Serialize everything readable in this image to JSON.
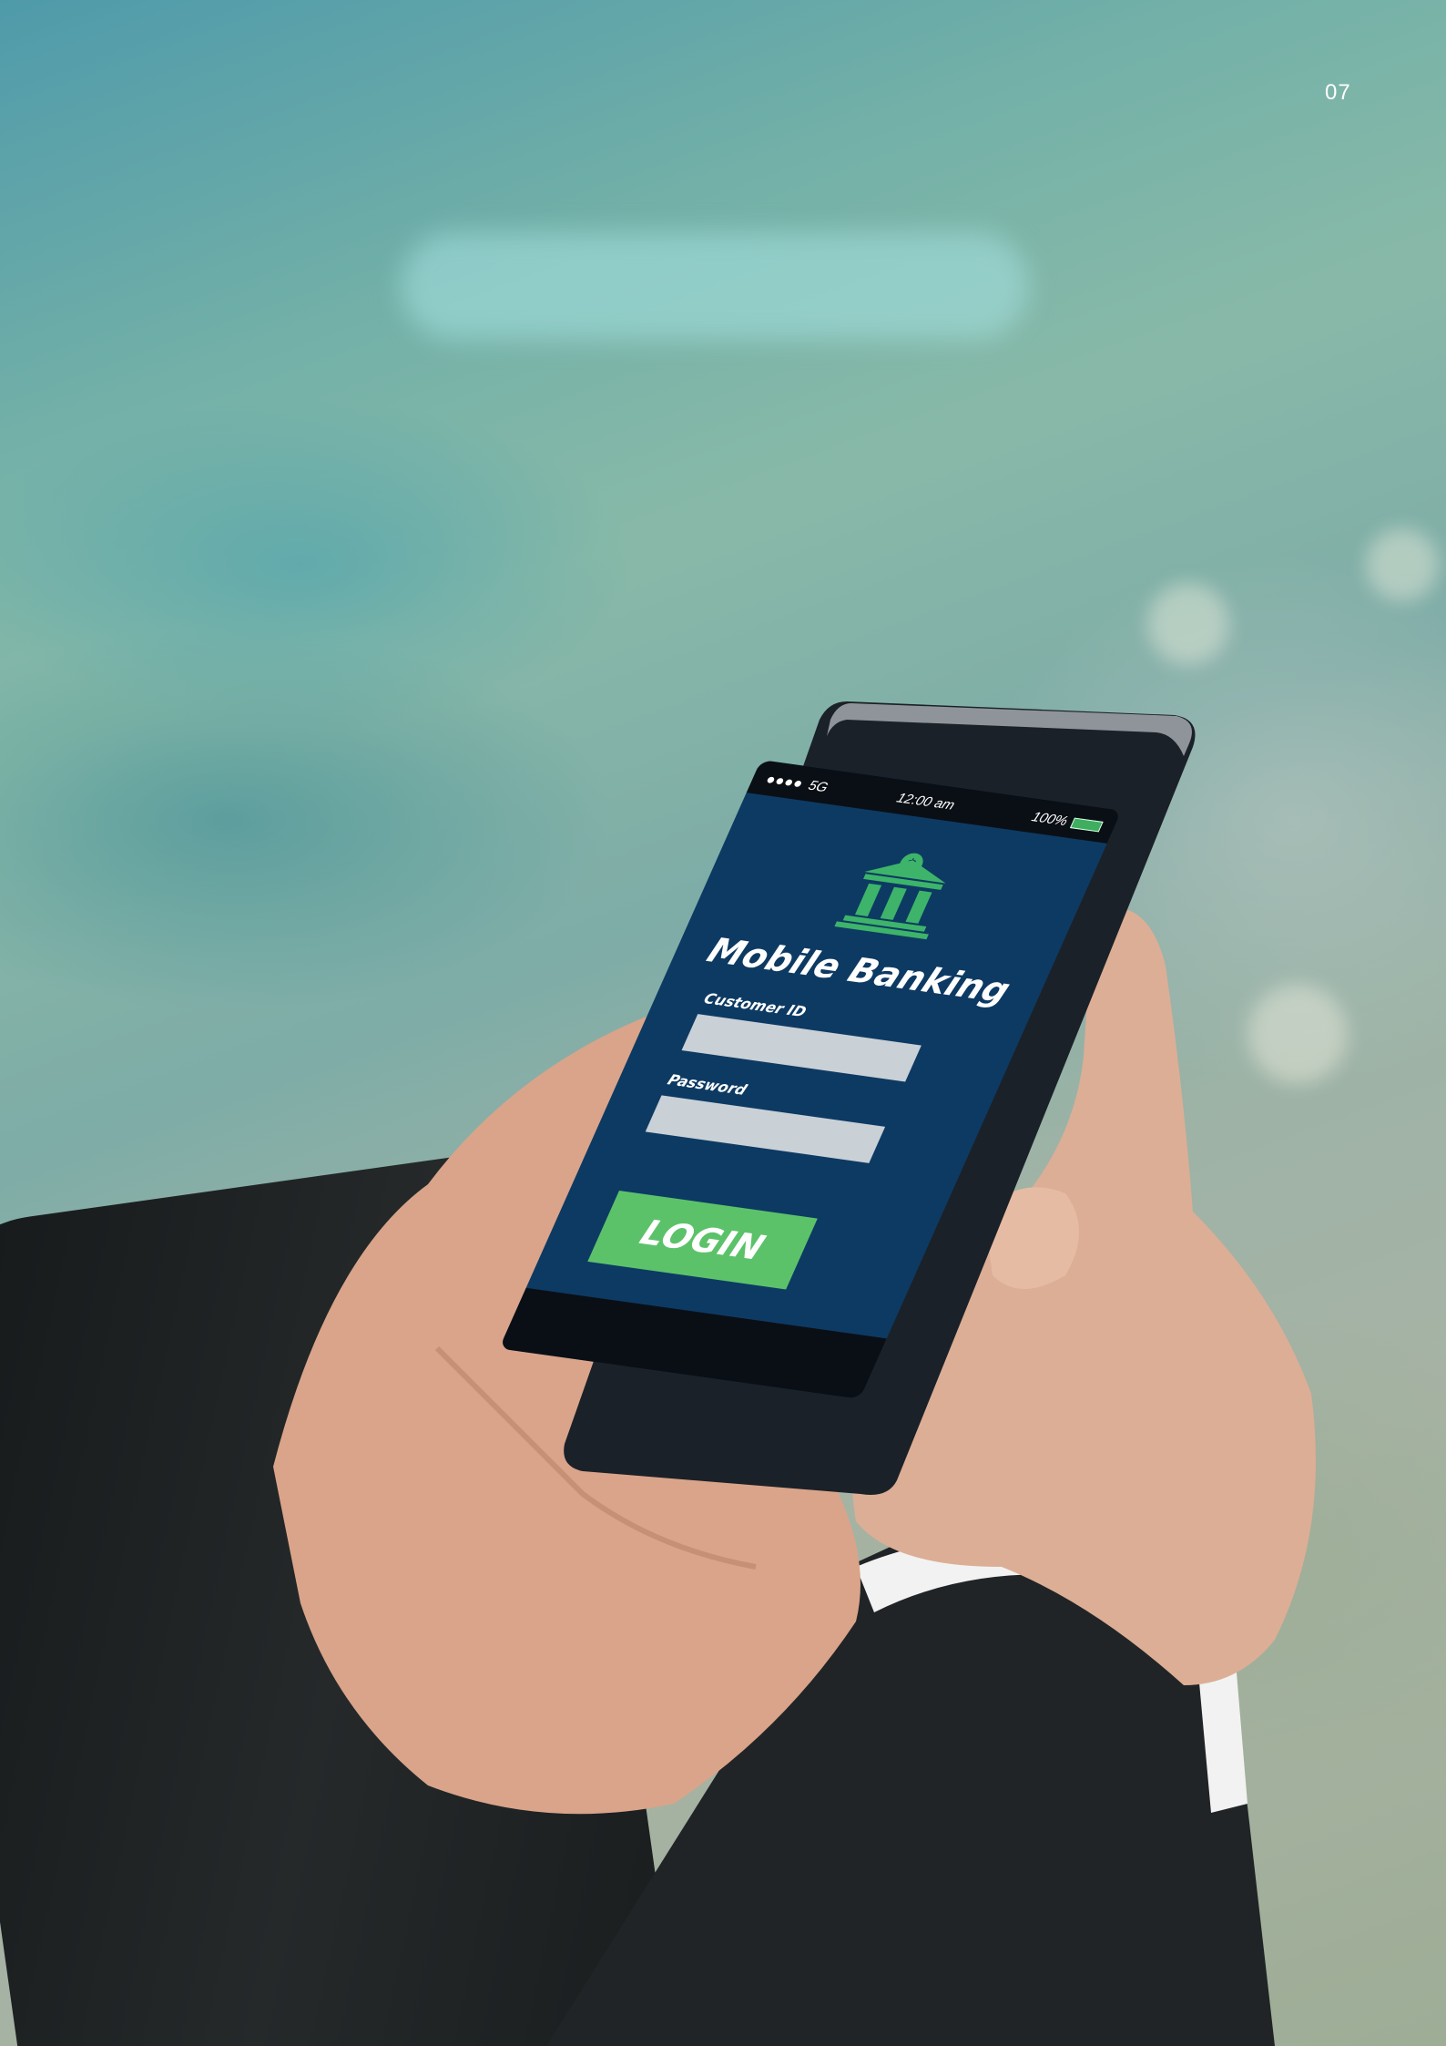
{
  "page": {
    "number": "07"
  },
  "phone": {
    "status_bar": {
      "network": "5G",
      "time": "12:00 am",
      "battery": "100%"
    },
    "app_title": "Mobile Banking",
    "logo_icon": "bank-icon",
    "customer_id_label": "Customer ID",
    "password_label": "Password",
    "login_label": "LOGIN"
  },
  "colors": {
    "screen_background": "#0d3a63",
    "accent_green": "#5cc26a",
    "field_gray": "#c9d0d6"
  }
}
